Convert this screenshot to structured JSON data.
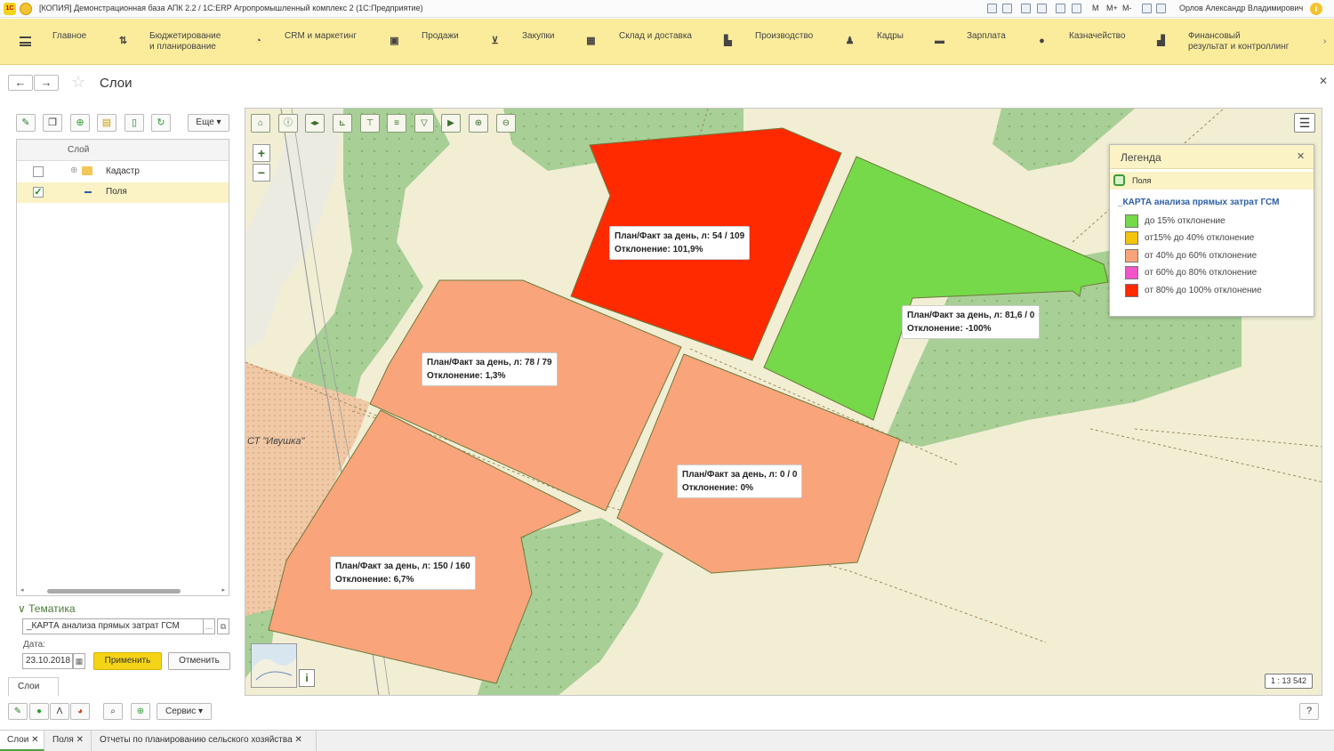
{
  "window": {
    "title": "[КОПИЯ] Демонстрационная база АПК 2.2 / 1С:ERP Агропромышленный комплекс 2   (1С:Предприятие)",
    "logo_text": "1С",
    "user": "Орлов Александр Владимирович",
    "memory_buttons": [
      "M",
      "M+",
      "M-"
    ]
  },
  "menu": {
    "items": [
      {
        "label": "Главное",
        "icon": "home-icon"
      },
      {
        "label": "Бюджетирование\nи планирование",
        "icon": "budget-icon"
      },
      {
        "label": "CRM и маркетинг",
        "icon": "crm-icon"
      },
      {
        "label": "Продажи",
        "icon": "sales-icon"
      },
      {
        "label": "Закупки",
        "icon": "cart-icon"
      },
      {
        "label": "Склад и доставка",
        "icon": "warehouse-icon"
      },
      {
        "label": "Производство",
        "icon": "factory-icon"
      },
      {
        "label": "Кадры",
        "icon": "person-icon"
      },
      {
        "label": "Зарплата",
        "icon": "wallet-icon"
      },
      {
        "label": "Казначейство",
        "icon": "treasury-icon"
      },
      {
        "label": "Финансовый\nрезультат и контроллинг",
        "icon": "finance-chart-icon"
      }
    ]
  },
  "page": {
    "title": "Слои"
  },
  "layers_panel": {
    "more_label": "Еще",
    "column_header": "Слой",
    "rows": [
      {
        "label": "Кадастр",
        "checked": false
      },
      {
        "label": "Поля",
        "checked": true
      }
    ],
    "thematic_header": "Тематика",
    "thematic_value": "_КАРТА анализа прямых затрат ГСМ",
    "date_label": "Дата:",
    "date_value": "23.10.2018",
    "apply_label": "Применить",
    "cancel_label": "Отменить",
    "tab_label": "Слои",
    "service_label": "Сервис"
  },
  "map": {
    "area_label": "СТ \"Ивушка\"",
    "scale": "1 : 13 542",
    "fields": [
      {
        "plan_fact": "План/Факт за день, л: 54 / 109",
        "deviation": "Отклонение: 101,9%",
        "color": "#ff2a00"
      },
      {
        "plan_fact": "План/Факт за день, л: 81,6 / 0",
        "deviation": "Отклонение: -100%",
        "color": "#76d94a"
      },
      {
        "plan_fact": "План/Факт за день, л: 78 / 79",
        "deviation": "Отклонение: 1,3%",
        "color": "#f9a47a"
      },
      {
        "plan_fact": "План/Факт за день, л: 0 / 0",
        "deviation": "Отклонение: 0%",
        "color": "#f9a47a"
      },
      {
        "plan_fact": "План/Факт за день, л: 150 / 160",
        "deviation": "Отклонение: 6,7%",
        "color": "#f9a47a"
      }
    ]
  },
  "legend": {
    "title": "Легенда",
    "layer": "Поля",
    "theme": "_КАРТА анализа прямых затрат ГСМ",
    "items": [
      {
        "label": "до 15% отклонение",
        "color": "#76d94a"
      },
      {
        "label": "от15% до 40% отклонение",
        "color": "#f2c40c"
      },
      {
        "label": "от 40% до 60% отклонение",
        "color": "#f9a47a"
      },
      {
        "label": "от 60% до 80% отклонение",
        "color": "#f054c8"
      },
      {
        "label": "от 80% до 100% отклонение",
        "color": "#ff2a00"
      }
    ]
  },
  "open_tabs": [
    "Слои",
    "Поля",
    "Отчеты по планированию сельского хозяйства"
  ]
}
